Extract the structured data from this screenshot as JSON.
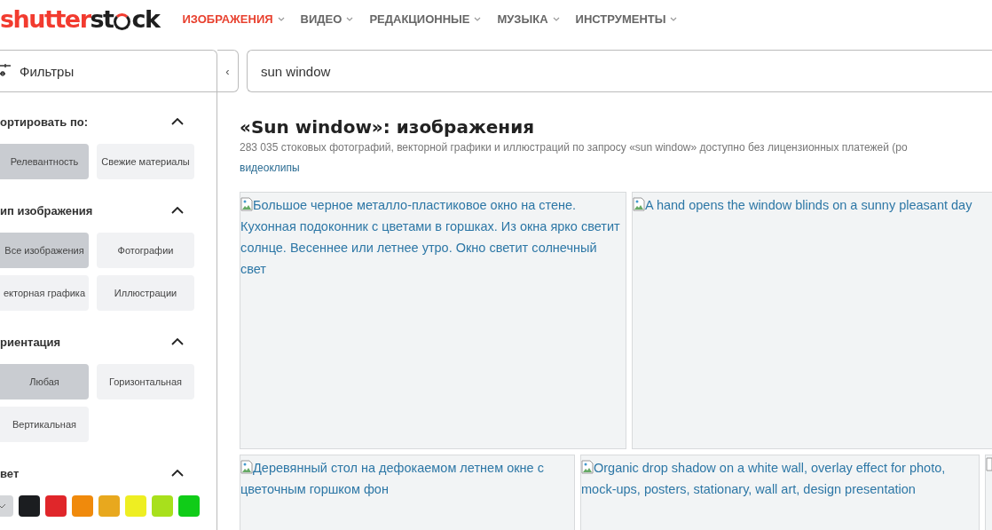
{
  "logo": {
    "part1": "shutter",
    "part2": "st",
    "part3": "ck"
  },
  "nav": [
    {
      "label": "ИЗОБРАЖЕНИЯ",
      "selected": true
    },
    {
      "label": "ВИДЕО",
      "selected": false
    },
    {
      "label": "РЕДАКЦИОННЫЕ",
      "selected": false
    },
    {
      "label": "МУЗЫКА",
      "selected": false
    },
    {
      "label": "ИНСТРУМЕНТЫ",
      "selected": false
    }
  ],
  "filters_button": "Фильтры",
  "collapse_button": "‹",
  "search": {
    "value": "sun window"
  },
  "sidebar": [
    {
      "title": "ортировать по:",
      "kind": "buttons",
      "options": [
        {
          "label": "Релевантность",
          "selected": true
        },
        {
          "label": "Свежие материалы",
          "selected": false
        }
      ]
    },
    {
      "title": "ип изображения",
      "kind": "buttons",
      "options": [
        {
          "label": "Все изображения",
          "selected": true
        },
        {
          "label": "Фотографии",
          "selected": false
        },
        {
          "label": "екторная графика",
          "selected": false
        },
        {
          "label": "Иллюстрации",
          "selected": false
        }
      ]
    },
    {
      "title": "риентация",
      "kind": "buttons",
      "options": [
        {
          "label": "Любая",
          "selected": true
        },
        {
          "label": "Горизонтальная",
          "selected": false
        },
        {
          "label": "Вертикальная",
          "selected": false
        }
      ]
    },
    {
      "title": "вет",
      "kind": "colors",
      "options": [
        {
          "color": "#d4d6d9",
          "selected": true
        },
        {
          "color": "#1b1d20",
          "selected": false
        },
        {
          "color": "#e0262a",
          "selected": false
        },
        {
          "color": "#f08a0c",
          "selected": false
        },
        {
          "color": "#e8a81e",
          "selected": false
        },
        {
          "color": "#eeee22",
          "selected": false
        },
        {
          "color": "#a8e01c",
          "selected": false
        },
        {
          "color": "#10cc18",
          "selected": false
        }
      ]
    }
  ],
  "heading": "«Sun window»: изображения",
  "description": "283 035 стоковых фотографий, векторной графики и иллюстраций по запросу «sun window» доступно без лицензионных платежей (ро",
  "related_link": "видеоклипы",
  "rows": [
    [
      {
        "alt": "Большое черное металло-пластиковое окно на стене. Кухонная подоконник с цветами в горшках. Из окна ярко светит солнце. Весеннее или летнее утро. Окно светит солнечный свет"
      },
      {
        "alt": "A hand opens the window blinds on a sunny pleasant day"
      }
    ],
    [
      {
        "alt": "Деревянный стол на дефокаемом летнем окне с цветочным горшком фон"
      },
      {
        "alt": "Organic drop shadow on a white wall, overlay effect for photo, mock-ups, posters, stationary, wall art, design presentation"
      },
      {
        "kind": "image"
      }
    ]
  ]
}
